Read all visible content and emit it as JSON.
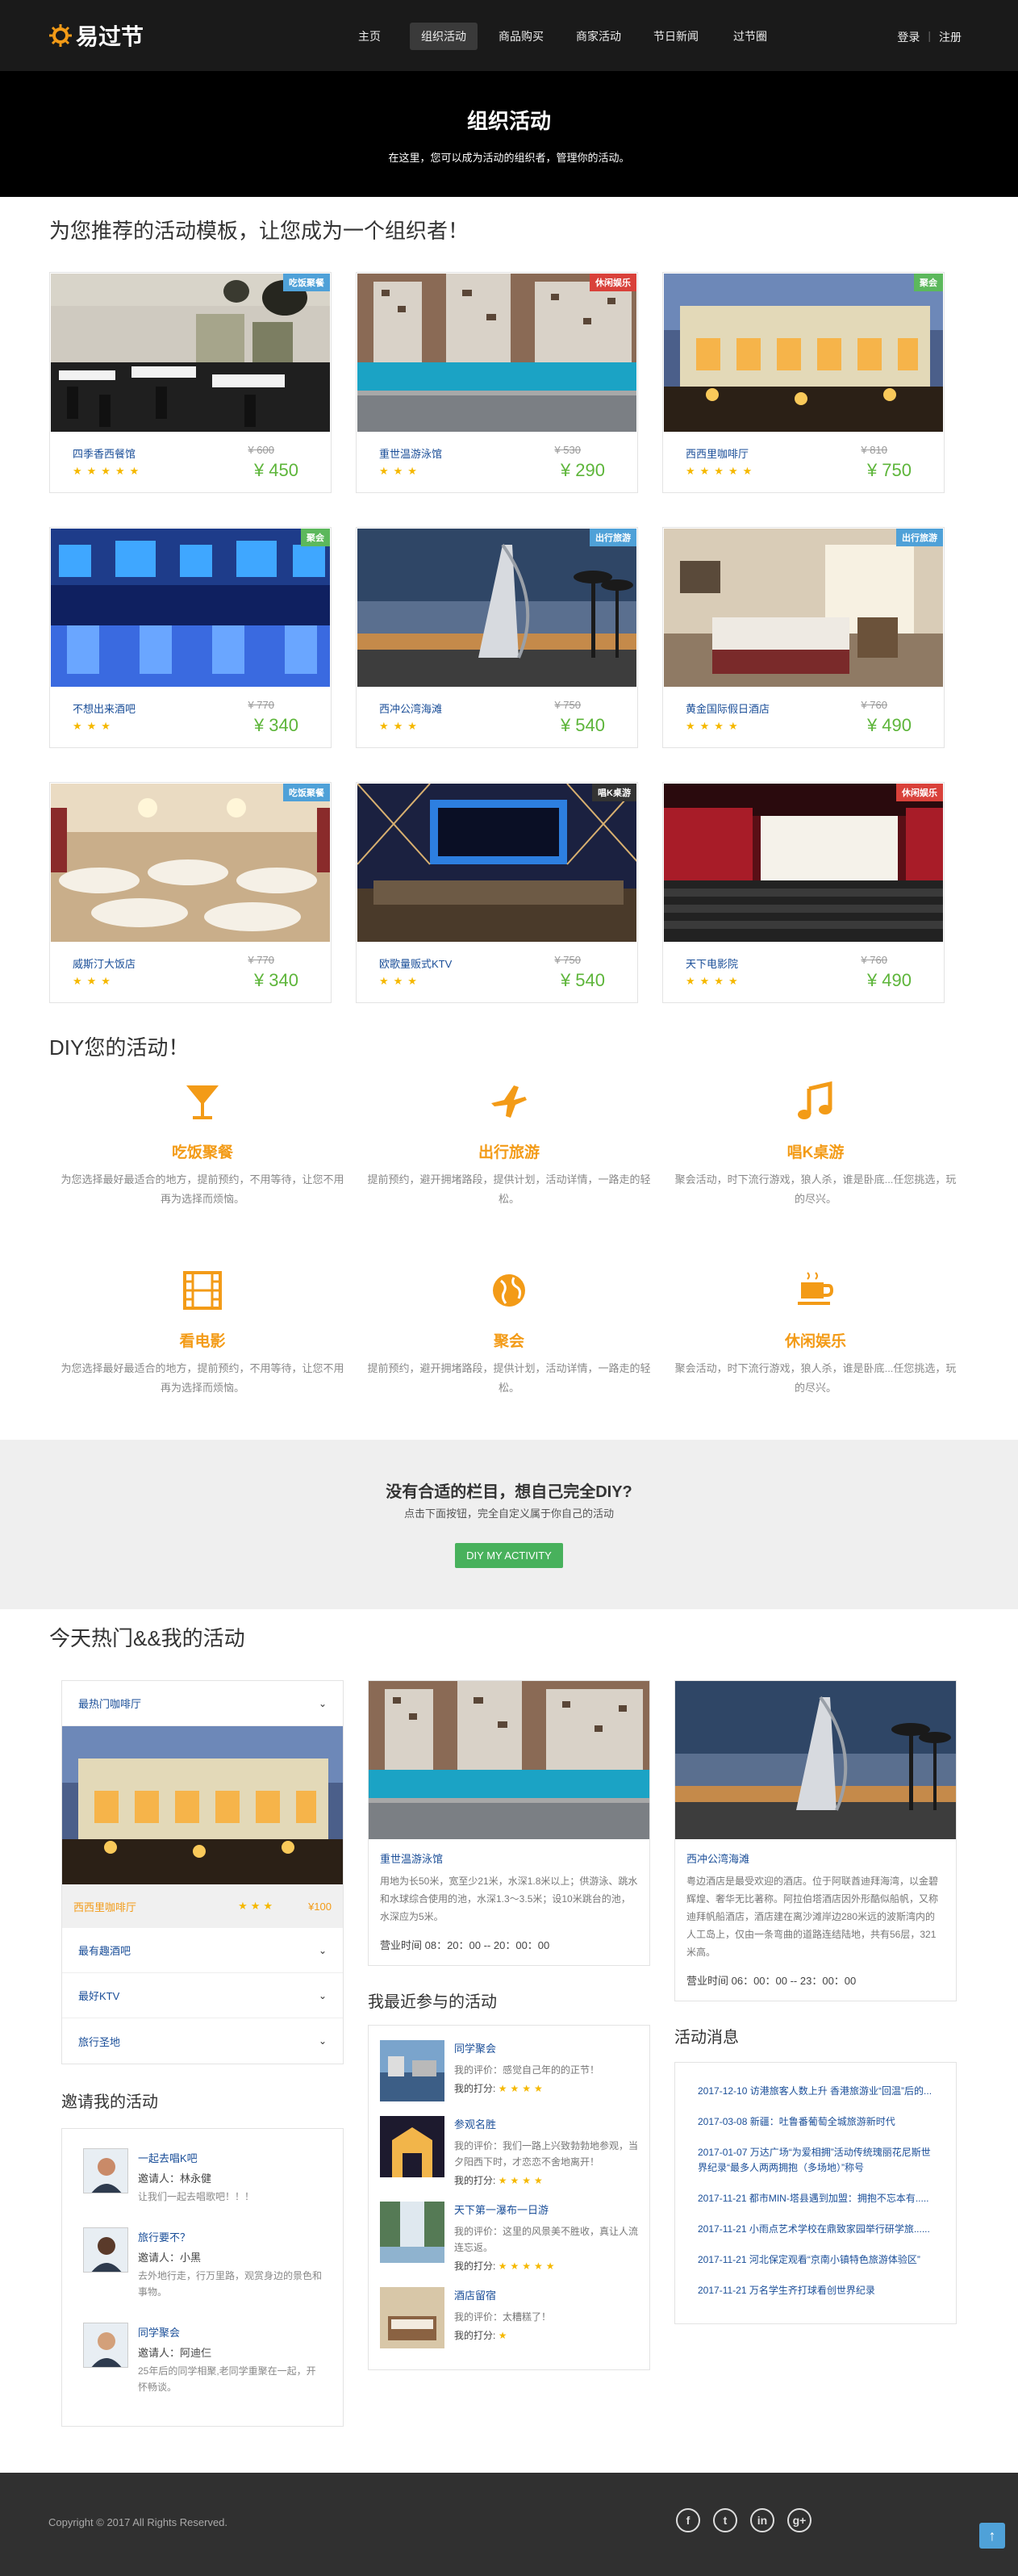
{
  "brand": {
    "name": "易过节",
    "accent": "#f39b17"
  },
  "nav": {
    "items": [
      "主页",
      "组织活动",
      "商品购买",
      "商家活动",
      "节日新闻",
      "过节圈"
    ],
    "active": 1,
    "login": "登录",
    "register": "注册"
  },
  "hero": {
    "title": "组织活动",
    "subtitle": "在这里，您可以成为活动的组织者，管理你的活动。"
  },
  "templates": {
    "heading": "为您推荐的活动模板，让您成为一个组织者！",
    "cards": [
      {
        "tag": "吃饭聚餐",
        "tag_color": "#4fa1d8",
        "name": "四季香西餐馆",
        "old": "¥ 600",
        "price": "¥ 450",
        "stars": "★★★★★",
        "scene": "restaurant"
      },
      {
        "tag": "休闲娱乐",
        "tag_color": "#d9413a",
        "name": "重世温游泳馆",
        "old": "¥ 530",
        "price": "¥ 290",
        "stars": "★★★",
        "scene": "pool"
      },
      {
        "tag": "聚会",
        "tag_color": "#5cb85c",
        "name": "西西里咖啡厅",
        "old": "¥ 810",
        "price": "¥ 750",
        "stars": "★★★★★",
        "scene": "cafe"
      },
      {
        "tag": "聚会",
        "tag_color": "#5cb85c",
        "name": "不想出来酒吧",
        "old": "¥ 770",
        "price": "¥ 340",
        "stars": "★★★",
        "scene": "bar"
      },
      {
        "tag": "出行旅游",
        "tag_color": "#4fa1d8",
        "name": "西冲公湾海滩",
        "old": "¥ 750",
        "price": "¥ 540",
        "stars": "★★★",
        "scene": "burj"
      },
      {
        "tag": "出行旅游",
        "tag_color": "#4fa1d8",
        "name": "黄金国际假日酒店",
        "old": "¥ 760",
        "price": "¥ 490",
        "stars": "★★★★",
        "scene": "bedroom"
      },
      {
        "tag": "吃饭聚餐",
        "tag_color": "#4fa1d8",
        "name": "威斯汀大饭店",
        "old": "¥ 770",
        "price": "¥ 340",
        "stars": "★★★",
        "scene": "banquet"
      },
      {
        "tag": "唱K桌游",
        "tag_color": "#333333",
        "name": "欧歌量贩式KTV",
        "old": "¥ 750",
        "price": "¥ 540",
        "stars": "★★★",
        "scene": "ktv"
      },
      {
        "tag": "休闲娱乐",
        "tag_color": "#d9413a",
        "name": "天下电影院",
        "old": "¥ 760",
        "price": "¥ 490",
        "stars": "★★★★",
        "scene": "cinema"
      }
    ]
  },
  "diy": {
    "heading": "DIY您的活动！",
    "features": [
      {
        "icon": "cocktail-icon",
        "title": "吃饭聚餐",
        "desc": "为您选择最好最适合的地方，提前预约，不用等待，让您不用再为选择而烦恼。"
      },
      {
        "icon": "plane-icon",
        "title": "出行旅游",
        "desc": "提前预约，避开拥堵路段，提供计划，活动详情，一路走的轻松。"
      },
      {
        "icon": "music-icon",
        "title": "唱K桌游",
        "desc": "聚会活动，时下流行游戏，狼人杀，谁是卧底...任您挑选，玩的尽兴。"
      },
      {
        "icon": "film-icon",
        "title": "看电影",
        "desc": "为您选择最好最适合的地方，提前预约，不用等待，让您不用再为选择而烦恼。"
      },
      {
        "icon": "globe-icon",
        "title": "聚会",
        "desc": "提前预约，避开拥堵路段，提供计划，活动详情，一路走的轻松。"
      },
      {
        "icon": "coffee-icon",
        "title": "休闲娱乐",
        "desc": "聚会活动，时下流行游戏，狼人杀，谁是卧底...任您挑选，玩的尽兴。"
      }
    ]
  },
  "cta": {
    "title": "没有合适的栏目，想自己完全DIY?",
    "subtitle": "点击下面按钮，完全自定义属于你自己的活动",
    "button": "DIY MY ACTIVITY"
  },
  "hot": {
    "heading": "今天热门&&我的活动",
    "accordion": {
      "open_label": "最热门咖啡厅",
      "open_name": "西西里咖啡厅",
      "open_stars": "★★★",
      "open_price": "¥100",
      "rows": [
        "最有趣酒吧",
        "最好KTV",
        "旅行圣地"
      ]
    },
    "invite": {
      "heading": "邀请我的活动",
      "items": [
        {
          "title": "一起去唱K吧",
          "inviter": "邀请人：林永健",
          "msg": "让我们一起去唱歌吧！！！"
        },
        {
          "title": "旅行要不？",
          "inviter": "邀请人：小黑",
          "msg": "去外地行走，行万里路，观赏身边的景色和事物。"
        },
        {
          "title": "同学聚会",
          "inviter": "邀请人：阿迪仨",
          "msg": "25年后的同学相聚,老同学重聚在一起，开怀畅谈。"
        }
      ]
    },
    "pool": {
      "name": "重世温游泳馆",
      "desc": "用地为长50米，宽至少21米，水深1.8米以上；供游泳、跳水和水球综合使用的池，水深1.3～3.5米；设10米跳台的池，水深应为5米。",
      "hours": "营业时间 08：20：00 -- 20：00：00"
    },
    "beach": {
      "name": "西冲公湾海滩",
      "desc": "粤边酒店是最受欢迎的酒店。位于阿联酋迪拜海湾，以金碧辉煌、奢华无比著称。阿拉伯塔酒店因外形酷似船帆，又称迪拜帆船酒店，酒店建在离沙滩岸边280米远的波斯湾内的人工岛上，仅由一条弯曲的道路连结陆地，共有56层，321米高。",
      "hours": "营业时间 06：00：00 -- 23：00：00"
    },
    "joined": {
      "heading": "我最近参与的活动",
      "items": [
        {
          "title": "同学聚会",
          "comment": "我的评价：感觉自己年的的正节！",
          "rating_label": "我的打分:",
          "stars": "★★★★",
          "scene": "harbor"
        },
        {
          "title": "参观名胜",
          "comment": "我的评价：我们一路上兴致勃勃地参观，当夕阳西下时，才恋恋不舍地离开！",
          "rating_label": "我的打分:",
          "stars": "★★★★",
          "scene": "arch"
        },
        {
          "title": "天下第一瀑布一日游",
          "comment": "我的评价：这里的风景美不胜收，真让人流连忘返。",
          "rating_label": "我的打分:",
          "stars": "★★★★★",
          "scene": "falls"
        },
        {
          "title": "酒店留宿",
          "comment": "我的评价：太糟糕了！",
          "rating_label": "我的打分:",
          "stars": "★",
          "scene": "room"
        }
      ]
    },
    "news": {
      "heading": "活动消息",
      "items": [
        "2017-12-10 访港旅客人数上升 香港旅游业“回温”后的...",
        "2017-03-08 新疆：吐鲁番葡萄全城旅游新时代",
        "2017-01-07 万达广场“为爱相拥”活动传统瑰丽花尼斯世界纪录“最多人两两拥抱（多场地）”称号",
        "2017-11-21 都市MIN-塔县遇到加盟：拥抱不忘本有.....",
        "2017-11-21 小雨点艺术学校在鼎致家园举行研学旅......",
        "2017-11-21 河北保定观看“京南小镇特色旅游体验区”",
        "2017-11-21 万名学生齐打球看创世界纪录"
      ]
    }
  },
  "footer": {
    "copyright": "Copyright © 2017 All Rights Reserved.",
    "social": [
      "f",
      "t",
      "in",
      "g+"
    ],
    "totop": "↑"
  }
}
